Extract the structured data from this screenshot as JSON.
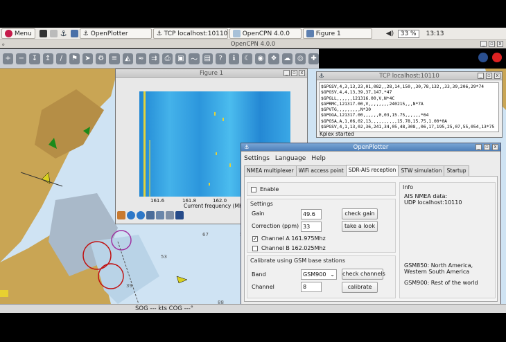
{
  "taskbar": {
    "menu_label": "Menu",
    "tasks": [
      {
        "label": "OpenPlotter"
      },
      {
        "label": "TCP localhost:10110"
      },
      {
        "label": "OpenCPN 4.0.0"
      },
      {
        "label": "Figure 1"
      }
    ],
    "cpu": "33 %",
    "clock": "13:13"
  },
  "opencpn": {
    "title": "OpenCPN 4.0.0",
    "status": "SOG --- kts  COG ---°",
    "depth_labels": [
      "64",
      "67",
      "53",
      "56",
      "39",
      "88"
    ]
  },
  "figure": {
    "title": "Figure 1",
    "x_ticks": [
      "161.6",
      "161.8",
      "162.0"
    ],
    "xlabel": "Current frequency (MH"
  },
  "tcp": {
    "title": "TCP localhost:10110",
    "lines": [
      "$GPGSV,4,3,13,23,01,082,,28,14,150,,30,78,132,,33,39,206,29*74",
      "$GPGSV,4,4,13,39,37,147,*47",
      "$GPGLL,,,,,,121316.00,V,N*4C",
      "$GPRMC,121317.00,V,,,,,,,,240215,,,N*7A",
      "$GPVTG,,,,,,,,,N*30",
      "$GPGGA,121317.00,,,,,,0,03,15.75,,,,,,*64",
      "$GPGSA,A,1,06,02,13,,,,,,,,,,15.78,15.75,1.00*0A",
      "$GPGSV,4,1,13,02,36,241,34,05,48,308,,06,17,195,25,07,55,054,13*75"
    ],
    "status": "Kplex started"
  },
  "openplotter": {
    "title": "OpenPlotter",
    "menu": [
      "Settings",
      "Language",
      "Help"
    ],
    "tabs": [
      "NMEA multiplexer",
      "WiFi access point",
      "SDR-AIS reception",
      "STW simulation",
      "Startup"
    ],
    "enable_label": "Enable",
    "settings_label": "Settings",
    "gain_label": "Gain",
    "gain_value": "49.6",
    "check_gain": "check gain",
    "correction_label": "Correction (ppm)",
    "correction_value": "33",
    "take_look": "take a look",
    "channel_a": "Channel A 161.975Mhz",
    "channel_b": "Channel B 162.025Mhz",
    "calibrate_label": "Calibrate using GSM base stations",
    "band_label": "Band",
    "band_value": "GSM900",
    "check_channels": "check channels",
    "channel_label": "Channel",
    "channel_value": "8",
    "calibrate": "calibrate",
    "info_label": "Info",
    "info_text_1": "AIS NMEA data:",
    "info_text_2": "UDP localhost:10110",
    "info_gsm850": "GSM850: North America, Western South America",
    "info_gsm900": "GSM900: Rest of the world"
  }
}
